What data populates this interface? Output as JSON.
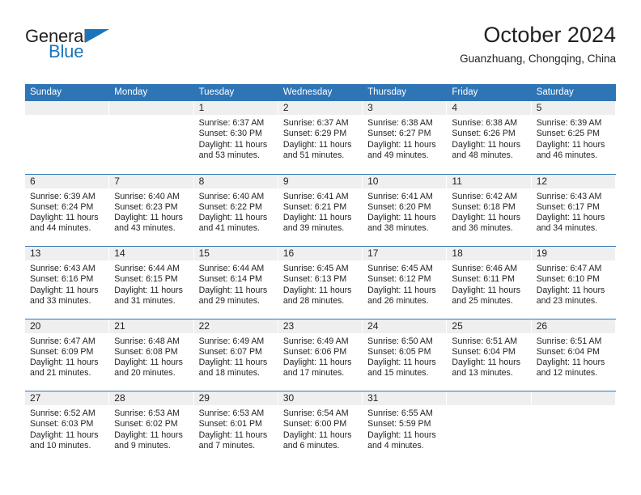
{
  "brand": {
    "name_top": "General",
    "name_bottom": "Blue",
    "color_dark": "#231f20",
    "color_blue": "#1b75bb"
  },
  "header": {
    "title": "October 2024",
    "subtitle": "Guanzhuang, Chongqing, China"
  },
  "theme": {
    "header_blue": "#2e75b6",
    "daynum_band": "#efefef",
    "text": "#231f20"
  },
  "weekday_headers": [
    "Sunday",
    "Monday",
    "Tuesday",
    "Wednesday",
    "Thursday",
    "Friday",
    "Saturday"
  ],
  "weeks": [
    [
      {
        "day": "",
        "lines": []
      },
      {
        "day": "",
        "lines": []
      },
      {
        "day": "1",
        "lines": [
          "Sunrise: 6:37 AM",
          "Sunset: 6:30 PM",
          "Daylight: 11 hours and 53 minutes."
        ]
      },
      {
        "day": "2",
        "lines": [
          "Sunrise: 6:37 AM",
          "Sunset: 6:29 PM",
          "Daylight: 11 hours and 51 minutes."
        ]
      },
      {
        "day": "3",
        "lines": [
          "Sunrise: 6:38 AM",
          "Sunset: 6:27 PM",
          "Daylight: 11 hours and 49 minutes."
        ]
      },
      {
        "day": "4",
        "lines": [
          "Sunrise: 6:38 AM",
          "Sunset: 6:26 PM",
          "Daylight: 11 hours and 48 minutes."
        ]
      },
      {
        "day": "5",
        "lines": [
          "Sunrise: 6:39 AM",
          "Sunset: 6:25 PM",
          "Daylight: 11 hours and 46 minutes."
        ]
      }
    ],
    [
      {
        "day": "6",
        "lines": [
          "Sunrise: 6:39 AM",
          "Sunset: 6:24 PM",
          "Daylight: 11 hours and 44 minutes."
        ]
      },
      {
        "day": "7",
        "lines": [
          "Sunrise: 6:40 AM",
          "Sunset: 6:23 PM",
          "Daylight: 11 hours and 43 minutes."
        ]
      },
      {
        "day": "8",
        "lines": [
          "Sunrise: 6:40 AM",
          "Sunset: 6:22 PM",
          "Daylight: 11 hours and 41 minutes."
        ]
      },
      {
        "day": "9",
        "lines": [
          "Sunrise: 6:41 AM",
          "Sunset: 6:21 PM",
          "Daylight: 11 hours and 39 minutes."
        ]
      },
      {
        "day": "10",
        "lines": [
          "Sunrise: 6:41 AM",
          "Sunset: 6:20 PM",
          "Daylight: 11 hours and 38 minutes."
        ]
      },
      {
        "day": "11",
        "lines": [
          "Sunrise: 6:42 AM",
          "Sunset: 6:18 PM",
          "Daylight: 11 hours and 36 minutes."
        ]
      },
      {
        "day": "12",
        "lines": [
          "Sunrise: 6:43 AM",
          "Sunset: 6:17 PM",
          "Daylight: 11 hours and 34 minutes."
        ]
      }
    ],
    [
      {
        "day": "13",
        "lines": [
          "Sunrise: 6:43 AM",
          "Sunset: 6:16 PM",
          "Daylight: 11 hours and 33 minutes."
        ]
      },
      {
        "day": "14",
        "lines": [
          "Sunrise: 6:44 AM",
          "Sunset: 6:15 PM",
          "Daylight: 11 hours and 31 minutes."
        ]
      },
      {
        "day": "15",
        "lines": [
          "Sunrise: 6:44 AM",
          "Sunset: 6:14 PM",
          "Daylight: 11 hours and 29 minutes."
        ]
      },
      {
        "day": "16",
        "lines": [
          "Sunrise: 6:45 AM",
          "Sunset: 6:13 PM",
          "Daylight: 11 hours and 28 minutes."
        ]
      },
      {
        "day": "17",
        "lines": [
          "Sunrise: 6:45 AM",
          "Sunset: 6:12 PM",
          "Daylight: 11 hours and 26 minutes."
        ]
      },
      {
        "day": "18",
        "lines": [
          "Sunrise: 6:46 AM",
          "Sunset: 6:11 PM",
          "Daylight: 11 hours and 25 minutes."
        ]
      },
      {
        "day": "19",
        "lines": [
          "Sunrise: 6:47 AM",
          "Sunset: 6:10 PM",
          "Daylight: 11 hours and 23 minutes."
        ]
      }
    ],
    [
      {
        "day": "20",
        "lines": [
          "Sunrise: 6:47 AM",
          "Sunset: 6:09 PM",
          "Daylight: 11 hours and 21 minutes."
        ]
      },
      {
        "day": "21",
        "lines": [
          "Sunrise: 6:48 AM",
          "Sunset: 6:08 PM",
          "Daylight: 11 hours and 20 minutes."
        ]
      },
      {
        "day": "22",
        "lines": [
          "Sunrise: 6:49 AM",
          "Sunset: 6:07 PM",
          "Daylight: 11 hours and 18 minutes."
        ]
      },
      {
        "day": "23",
        "lines": [
          "Sunrise: 6:49 AM",
          "Sunset: 6:06 PM",
          "Daylight: 11 hours and 17 minutes."
        ]
      },
      {
        "day": "24",
        "lines": [
          "Sunrise: 6:50 AM",
          "Sunset: 6:05 PM",
          "Daylight: 11 hours and 15 minutes."
        ]
      },
      {
        "day": "25",
        "lines": [
          "Sunrise: 6:51 AM",
          "Sunset: 6:04 PM",
          "Daylight: 11 hours and 13 minutes."
        ]
      },
      {
        "day": "26",
        "lines": [
          "Sunrise: 6:51 AM",
          "Sunset: 6:04 PM",
          "Daylight: 11 hours and 12 minutes."
        ]
      }
    ],
    [
      {
        "day": "27",
        "lines": [
          "Sunrise: 6:52 AM",
          "Sunset: 6:03 PM",
          "Daylight: 11 hours and 10 minutes."
        ]
      },
      {
        "day": "28",
        "lines": [
          "Sunrise: 6:53 AM",
          "Sunset: 6:02 PM",
          "Daylight: 11 hours and 9 minutes."
        ]
      },
      {
        "day": "29",
        "lines": [
          "Sunrise: 6:53 AM",
          "Sunset: 6:01 PM",
          "Daylight: 11 hours and 7 minutes."
        ]
      },
      {
        "day": "30",
        "lines": [
          "Sunrise: 6:54 AM",
          "Sunset: 6:00 PM",
          "Daylight: 11 hours and 6 minutes."
        ]
      },
      {
        "day": "31",
        "lines": [
          "Sunrise: 6:55 AM",
          "Sunset: 5:59 PM",
          "Daylight: 11 hours and 4 minutes."
        ]
      },
      {
        "day": "",
        "lines": []
      },
      {
        "day": "",
        "lines": []
      }
    ]
  ]
}
